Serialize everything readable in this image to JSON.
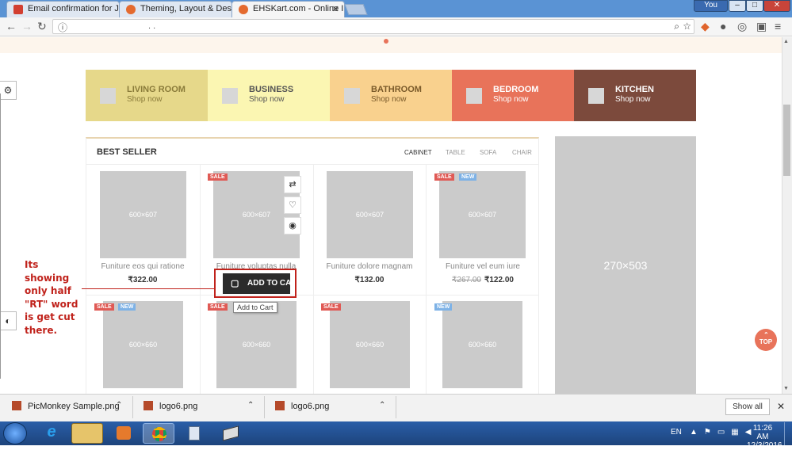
{
  "browser": {
    "tabs": [
      {
        "title": "Email confirmation for Je",
        "icon": "gmail-icon",
        "color": "#d23f31"
      },
      {
        "title": "Theming, Layout & Desi",
        "icon": "magento-icon",
        "color": "#e46a2e"
      },
      {
        "title": "EHSKart.com - Online In",
        "icon": "magento-icon",
        "color": "#e46a2e"
      }
    ],
    "user_label": "You",
    "window_controls": {
      "minimize": "–",
      "maximize": "□",
      "close": "✕"
    },
    "url": ".       .",
    "info_icon": "ⓘ"
  },
  "categories": [
    {
      "title": "LIVING ROOM",
      "sub": "Shop now",
      "bg": "#e6d88a",
      "fg": "#8a7b3a"
    },
    {
      "title": "BUSINESS",
      "sub": "Shop now",
      "bg": "#fbf6b2",
      "fg": "#555"
    },
    {
      "title": "BATHROOM",
      "sub": "Shop now",
      "bg": "#f9d18e",
      "fg": "#7a5a2a"
    },
    {
      "title": "BEDROOM",
      "sub": "Shop now",
      "bg": "#e8735a",
      "fg": "#ffffff"
    },
    {
      "title": "KITCHEN",
      "sub": "Shop now",
      "bg": "#7c4a3c",
      "fg": "#ffffff"
    }
  ],
  "best_seller": {
    "title": "BEST SELLER",
    "filters": [
      "CABINET",
      "TABLE",
      "SOFA",
      "CHAIR"
    ]
  },
  "products_row1": [
    {
      "img": "600×607",
      "name": "Funiture eos qui ratione",
      "price": "₹322.00",
      "old": "",
      "sale": "",
      "new": ""
    },
    {
      "img": "600×607",
      "name": "Funiture voluptas nulla",
      "price": "",
      "old": "",
      "sale": "SALE",
      "new": ""
    },
    {
      "img": "600×607",
      "name": "Funiture dolore magnam",
      "price": "₹132.00",
      "old": "",
      "sale": "",
      "new": ""
    },
    {
      "img": "600×607",
      "name": "Funiture vel eum iure",
      "price": "₹122.00",
      "old": "₹267.00",
      "sale": "SALE",
      "new": "NEW"
    }
  ],
  "products_row2": [
    {
      "img": "600×660",
      "sale": "SALE",
      "new": "NEW"
    },
    {
      "img": "600×660",
      "sale": "SALE",
      "new": ""
    },
    {
      "img": "600×660",
      "sale": "SALE",
      "new": ""
    },
    {
      "img": "600×660",
      "sale": "",
      "new": "NEW"
    }
  ],
  "add_to_cart": {
    "label": "ADD TO CAR",
    "tooltip": "Add to Cart"
  },
  "banner": {
    "text": "270×503"
  },
  "annotation": {
    "text": "Its showing only half \"RT\" word is get cut there.",
    "color": "#c0221b"
  },
  "top_button": {
    "label": "TOP"
  },
  "downloads": {
    "items": [
      "PicMonkey Sample.png",
      "logo6.png",
      "logo6.png"
    ],
    "show_all": "Show all"
  },
  "taskbar": {
    "lang": "EN",
    "time": "11:26 AM",
    "date": "12/3/2016"
  }
}
